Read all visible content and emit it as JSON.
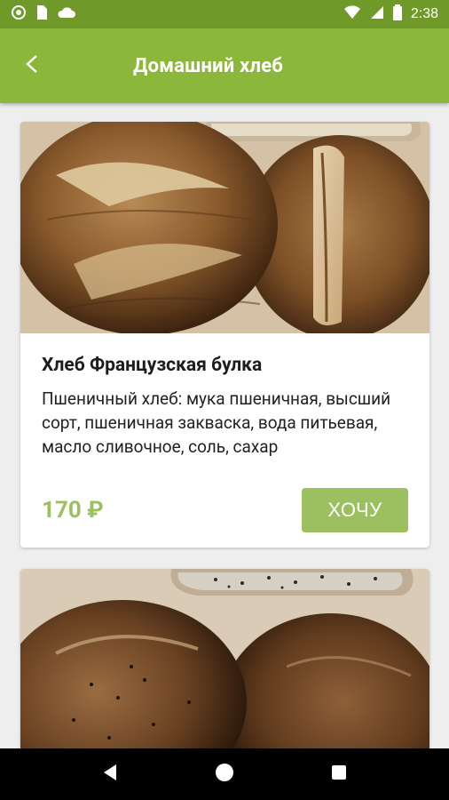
{
  "status_bar": {
    "time": "2:38",
    "icons": [
      "circle-icon",
      "sim-icon",
      "cloud-icon",
      "wifi-icon",
      "signal-icon",
      "battery-icon"
    ]
  },
  "app_bar": {
    "title": "Домашний хлеб",
    "back_icon": "back-arrow-icon"
  },
  "colors": {
    "status_bar": "#6f9a2a",
    "app_bar": "#8bb73b",
    "accent": "#9cc060",
    "background": "#eeeeee"
  },
  "products": [
    {
      "title": "Хлеб Французская булка",
      "description": "Пшеничный хлеб: мука пшеничная, высший сорт, пшеничная закваска, вода питьевая, масло сливочное, соль, сахар",
      "price": "170 ₽",
      "button_label": "ХОЧУ"
    },
    {
      "title": "",
      "description": "",
      "price": "",
      "button_label": ""
    }
  ],
  "nav_bar": {
    "buttons": [
      "back-triangle-icon",
      "home-circle-icon",
      "recents-square-icon"
    ]
  }
}
